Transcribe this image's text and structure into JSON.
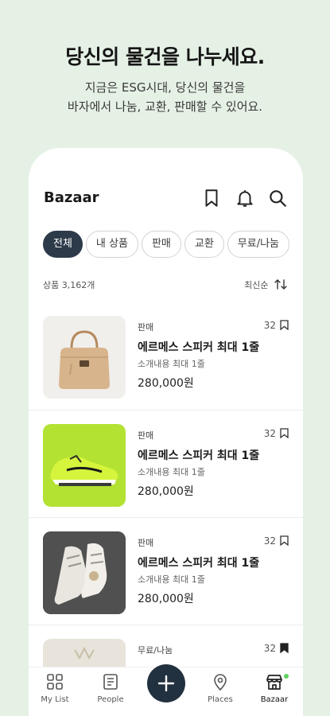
{
  "promo": {
    "title": "당신의 물건을 나누세요.",
    "subtitle_line1": "지금은 ESG시대, 당신의 물건을",
    "subtitle_line2": "바자에서 나눔, 교환, 판매할 수 있어요."
  },
  "header": {
    "title": "Bazaar",
    "icons": [
      "bookmark-icon",
      "bell-icon",
      "search-icon"
    ]
  },
  "filters": [
    "전체",
    "내 상품",
    "판매",
    "교환",
    "무료/나눔"
  ],
  "active_filter": "전체",
  "meta": {
    "count_label": "상품 3,162개",
    "sort_label": "최신순"
  },
  "items": [
    {
      "type": "판매",
      "count": "32",
      "title": "에르메스 스피커 최대 1줄",
      "desc": "소개내용 최대 1줄",
      "price": "280,000원",
      "bookmarked": false,
      "image": "handbag"
    },
    {
      "type": "판매",
      "count": "32",
      "title": "에르메스 스피커 최대 1줄",
      "desc": "소개내용 최대 1줄",
      "price": "280,000원",
      "bookmarked": false,
      "image": "sneaker-green"
    },
    {
      "type": "판매",
      "count": "32",
      "title": "에르메스 스피커 최대 1줄",
      "desc": "소개내용 최대 1줄",
      "price": "280,000원",
      "bookmarked": false,
      "image": "sneaker-white"
    },
    {
      "type": "무료/나눔",
      "count": "32",
      "title": "",
      "desc": "",
      "price": "",
      "bookmarked": true,
      "image": "partial"
    }
  ],
  "tabs": {
    "mylist": "My List",
    "people": "People",
    "places": "Places",
    "bazaar": "Bazaar"
  },
  "colors": {
    "background": "#e6f1e6",
    "active_chip": "#2d3a4a",
    "fab": "#22313f",
    "badge": "#5fd35f"
  }
}
